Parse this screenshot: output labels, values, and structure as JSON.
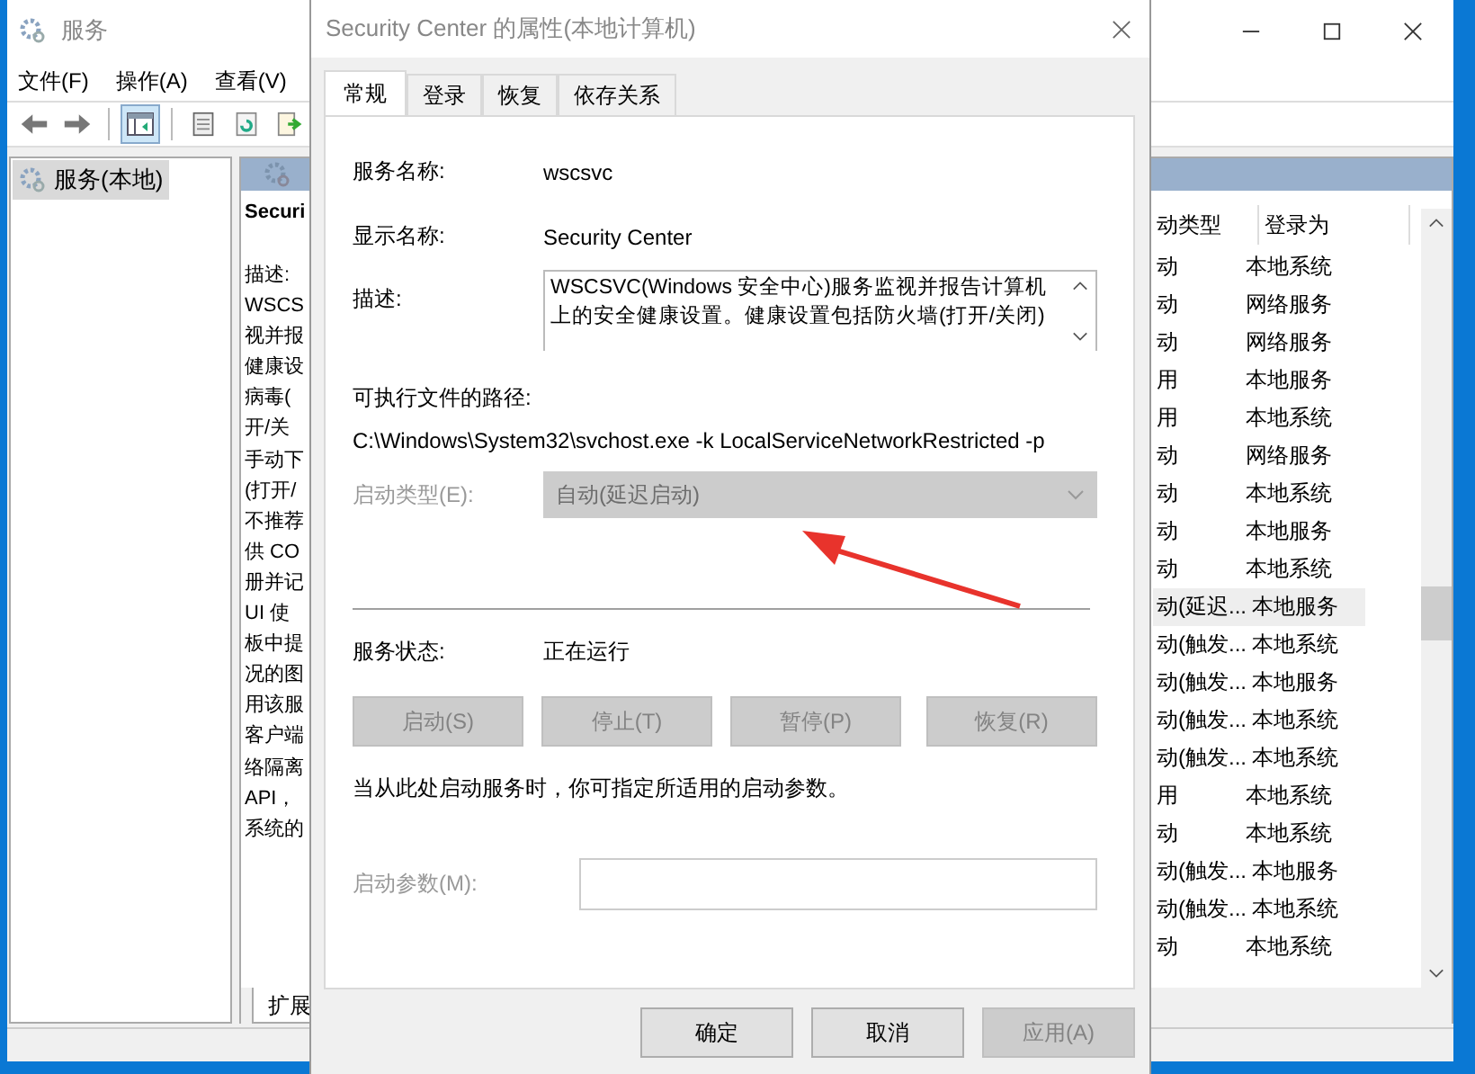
{
  "services_window": {
    "title": "服务",
    "menu": [
      "文件(F)",
      "操作(A)",
      "查看(V)"
    ],
    "toolbar": [
      {
        "kind": "back",
        "selected": false
      },
      {
        "kind": "forward",
        "selected": false
      },
      {
        "kind": "tree",
        "selected": true
      },
      {
        "kind": "properties",
        "selected": false
      },
      {
        "kind": "refresh",
        "selected": false
      },
      {
        "kind": "export",
        "selected": false
      }
    ],
    "tree": [
      {
        "label": "服务(本地)",
        "selected": true
      }
    ],
    "detail_title": "Securi",
    "description_lines": [
      "描述:",
      "WSCS",
      "视并报",
      "健康设",
      "病毒(",
      "开/关",
      "手动下",
      "(打开/",
      "不推荐",
      "供 CO",
      "册并记",
      "UI 使",
      "板中提",
      "况的图",
      "用该服",
      "客户端",
      "络隔离",
      "API，",
      "系统的"
    ],
    "columns": [
      "动类型",
      "登录为"
    ],
    "rows": [
      {
        "start_type": "动",
        "logon": "本地系统",
        "selected": false
      },
      {
        "start_type": "动",
        "logon": "网络服务",
        "selected": false
      },
      {
        "start_type": "动",
        "logon": "网络服务",
        "selected": false
      },
      {
        "start_type": "用",
        "logon": "本地服务",
        "selected": false
      },
      {
        "start_type": "用",
        "logon": "本地系统",
        "selected": false
      },
      {
        "start_type": "动",
        "logon": "网络服务",
        "selected": false
      },
      {
        "start_type": "动",
        "logon": "本地系统",
        "selected": false
      },
      {
        "start_type": "动",
        "logon": "本地服务",
        "selected": false
      },
      {
        "start_type": "动",
        "logon": "本地系统",
        "selected": false
      },
      {
        "start_type": "动(延迟...",
        "logon": "本地服务",
        "selected": true
      },
      {
        "start_type": "动(触发...",
        "logon": "本地系统",
        "selected": false
      },
      {
        "start_type": "动(触发...",
        "logon": "本地服务",
        "selected": false
      },
      {
        "start_type": "动(触发...",
        "logon": "本地系统",
        "selected": false
      },
      {
        "start_type": "动(触发...",
        "logon": "本地系统",
        "selected": false
      },
      {
        "start_type": "用",
        "logon": "本地系统",
        "selected": false
      },
      {
        "start_type": "动",
        "logon": "本地系统",
        "selected": false
      },
      {
        "start_type": "动(触发...",
        "logon": "本地服务",
        "selected": false
      },
      {
        "start_type": "动(触发...",
        "logon": "本地系统",
        "selected": false
      },
      {
        "start_type": "动",
        "logon": "本地系统",
        "selected": false
      }
    ],
    "bottom_tabs": [
      {
        "label": "扩展",
        "selected": true
      }
    ]
  },
  "dialog": {
    "title": "Security Center 的属性(本地计算机)",
    "tabs": [
      {
        "label": "常规",
        "selected": true
      },
      {
        "label": "登录",
        "selected": false
      },
      {
        "label": "恢复",
        "selected": false
      },
      {
        "label": "依存关系",
        "selected": false
      }
    ],
    "service_name": {
      "label": "服务名称:",
      "value": "wscsvc"
    },
    "display_name": {
      "label": "显示名称:",
      "value": "Security Center"
    },
    "description": {
      "label": "描述:",
      "lines": [
        "WSCSVC(Windows 安全中心)服务监视并报告计算机",
        "上的安全健康设置。健康设置包括防火墙(打开/关闭)"
      ]
    },
    "path": {
      "label": "可执行文件的路径:",
      "value": "C:\\Windows\\System32\\svchost.exe -k LocalServiceNetworkRestricted -p"
    },
    "startup_type": {
      "label": "启动类型(E):",
      "value": "自动(延迟启动)",
      "disabled": true
    },
    "status": {
      "label": "服务状态:",
      "value": "正在运行"
    },
    "service_buttons": [
      {
        "label": "启动(S)",
        "disabled": true
      },
      {
        "label": "停止(T)",
        "disabled": true
      },
      {
        "label": "暂停(P)",
        "disabled": true
      },
      {
        "label": "恢复(R)",
        "disabled": true
      }
    ],
    "hint": "当从此处启动服务时，你可指定所适用的启动参数。",
    "start_params": {
      "label": "启动参数(M):",
      "disabled": true
    },
    "buttons": [
      {
        "label": "确定",
        "disabled": false
      },
      {
        "label": "取消",
        "disabled": false
      },
      {
        "label": "应用(A)",
        "disabled": true
      }
    ]
  }
}
